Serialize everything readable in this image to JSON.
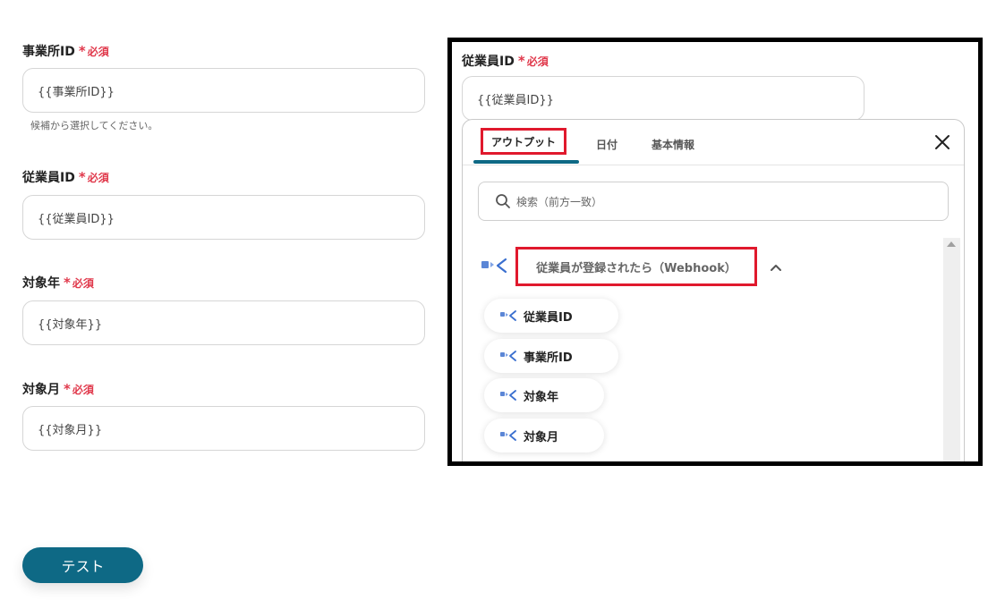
{
  "form": {
    "required_label": "必須",
    "fields": [
      {
        "label": "事業所ID",
        "value": "{{事業所ID}}",
        "hint": "候補から選択してください。"
      },
      {
        "label": "従業員ID",
        "value": "{{従業員ID}}"
      },
      {
        "label": "対象年",
        "value": "{{対象年}}"
      },
      {
        "label": "対象月",
        "value": "{{対象月}}"
      }
    ],
    "test_button": "テスト"
  },
  "panel": {
    "field_label": "従業員ID",
    "required_label": "必須",
    "field_value": "{{従業員ID}}",
    "tabs": [
      "アウトプット",
      "日付",
      "基本情報"
    ],
    "active_tab": "アウトプット",
    "search_placeholder": "検索（前方一致）",
    "group_title": "従業員が登録されたら（Webhook）",
    "items": [
      "従業員ID",
      "事業所ID",
      "対象年",
      "対象月"
    ]
  },
  "colors": {
    "accent": "#0e6985",
    "required": "#e0384b",
    "highlight": "#e0192d"
  }
}
